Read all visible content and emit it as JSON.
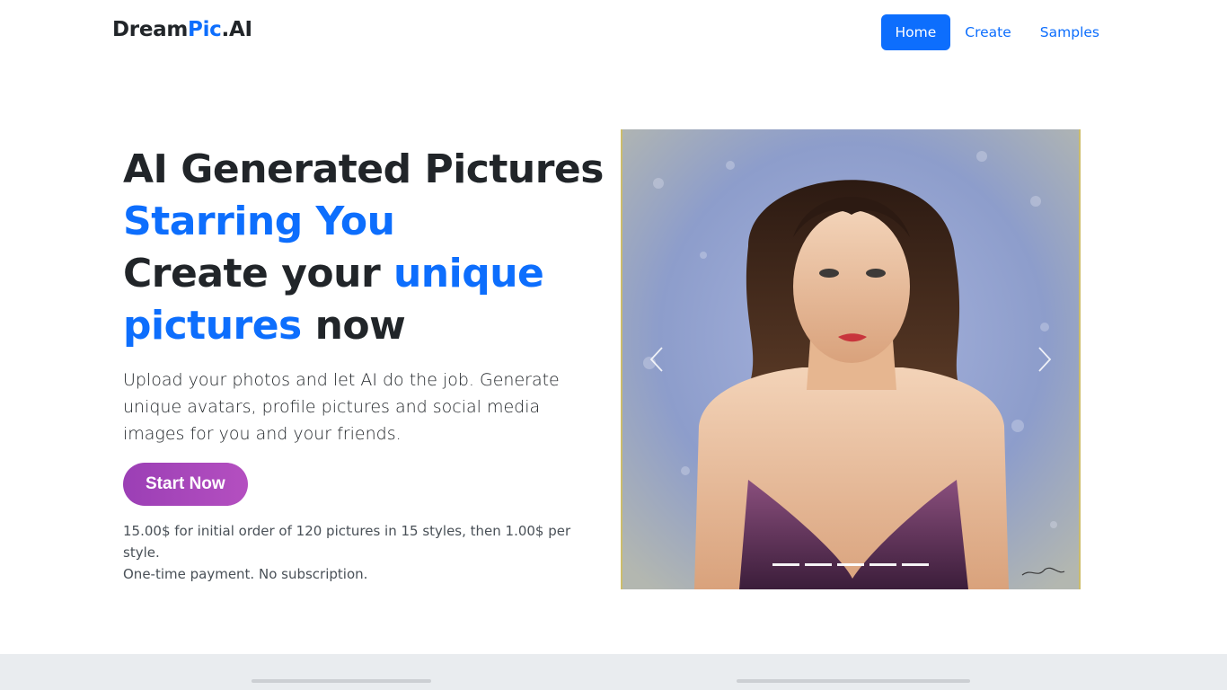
{
  "brand": {
    "part1": "Dream",
    "part2": "Pic",
    "part3": ".AI"
  },
  "nav": {
    "items": [
      {
        "label": "Home",
        "active": true
      },
      {
        "label": "Create"
      },
      {
        "label": "Samples"
      }
    ]
  },
  "hero": {
    "line1": "AI Generated Pictures",
    "line2": "Starring You",
    "line3_a": "Create your ",
    "line3_b": "unique",
    "line4_a": "pictures",
    "line4_b": " now",
    "lead": "Upload your photos and let AI do the job. Generate unique avatars, profile pictures and social media images for you and your friends.",
    "cta_label": "Start Now",
    "price_line1": "15.00$ for initial order of 120 pictures in 15 styles, then 1.00$ per style.",
    "price_line2": "One-time payment. No subscription."
  },
  "carousel": {
    "prev_icon": "chevron-left-icon",
    "next_icon": "chevron-right-icon",
    "slide_count": 5,
    "active_index": 0
  },
  "colors": {
    "primary": "#0d6efd",
    "cta_start": "#9b3fb5",
    "cta_end": "#b44fc0",
    "band": "#e9ecef"
  }
}
